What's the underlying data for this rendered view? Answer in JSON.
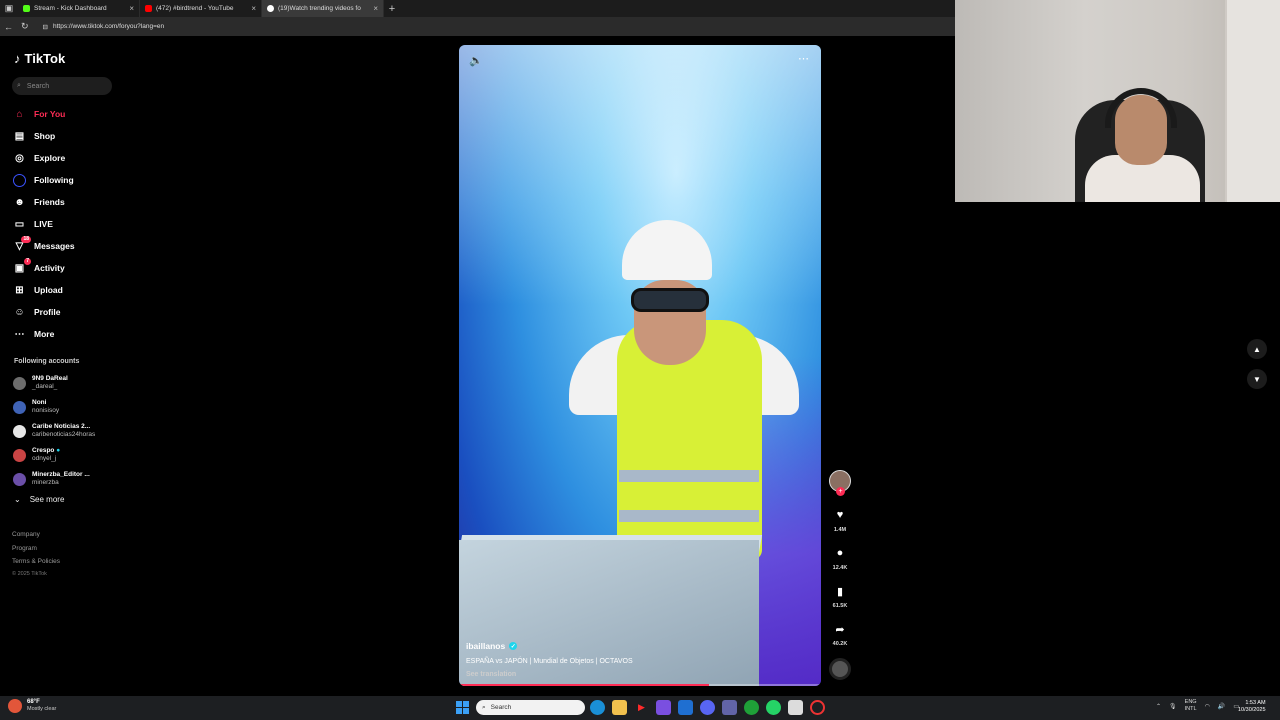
{
  "browser": {
    "tabs": [
      {
        "title": "Stream - Kick Dashboard",
        "color": "#53fc18"
      },
      {
        "title": "(472) #birdtrend - YouTube",
        "color": "#ff0000"
      },
      {
        "title": "(19)Watch trending videos fo",
        "color": "#ffffff"
      }
    ],
    "url": "https://www.tiktok.com/foryou?lang=en"
  },
  "sidebar": {
    "logo": "TikTok",
    "search_placeholder": "Search",
    "nav": [
      {
        "label": "For You",
        "icon": "home-icon",
        "glyph": "⌂",
        "active": true
      },
      {
        "label": "Shop",
        "icon": "shop-icon",
        "glyph": "🛍"
      },
      {
        "label": "Explore",
        "icon": "compass-icon",
        "glyph": "◎"
      },
      {
        "label": "Following",
        "icon": "following-icon",
        "glyph": "○"
      },
      {
        "label": "Friends",
        "icon": "friends-icon",
        "glyph": "👥"
      },
      {
        "label": "LIVE",
        "icon": "live-icon",
        "glyph": "▭"
      },
      {
        "label": "Messages",
        "icon": "messages-icon",
        "glyph": "▽",
        "badge": "18"
      },
      {
        "label": "Activity",
        "icon": "activity-icon",
        "glyph": "▣",
        "badge": "7"
      },
      {
        "label": "Upload",
        "icon": "upload-icon",
        "glyph": "⊕"
      },
      {
        "label": "Profile",
        "icon": "profile-icon",
        "glyph": "☺"
      },
      {
        "label": "More",
        "icon": "more-icon",
        "glyph": "⋯"
      }
    ],
    "following_title": "Following accounts",
    "accounts": [
      {
        "name": "9N9 DaReal",
        "handle": "_dareal_"
      },
      {
        "name": "Noni",
        "handle": "nonisisoy"
      },
      {
        "name": "Caribe Noticias 2...",
        "handle": "caribenoticias24horas"
      },
      {
        "name": "Crespo",
        "handle": "odnyel_j"
      },
      {
        "name": "Minerzba_Editor ...",
        "handle": "minerzba"
      }
    ],
    "see_more": "See more",
    "footer": [
      "Company",
      "Program",
      "Terms & Policies"
    ],
    "copyright": "© 2025 TikTok"
  },
  "video": {
    "username": "ibaillanos",
    "description": "ESPAÑA vs JAPÓN | Mundial de Objetos | OCTAVOS",
    "see_translation": "See translation",
    "progress": 0.69
  },
  "actions": {
    "likes": "1.4M",
    "comments": "12.4K",
    "saves": "61.5K",
    "shares": "40.2K"
  },
  "taskbar": {
    "temp": "68°F",
    "condition": "Mostly clear",
    "search_placeholder": "Search",
    "lang_top": "ENG",
    "lang_bottom": "INTL",
    "time": "1:53 AM",
    "date": "10/30/2025"
  }
}
